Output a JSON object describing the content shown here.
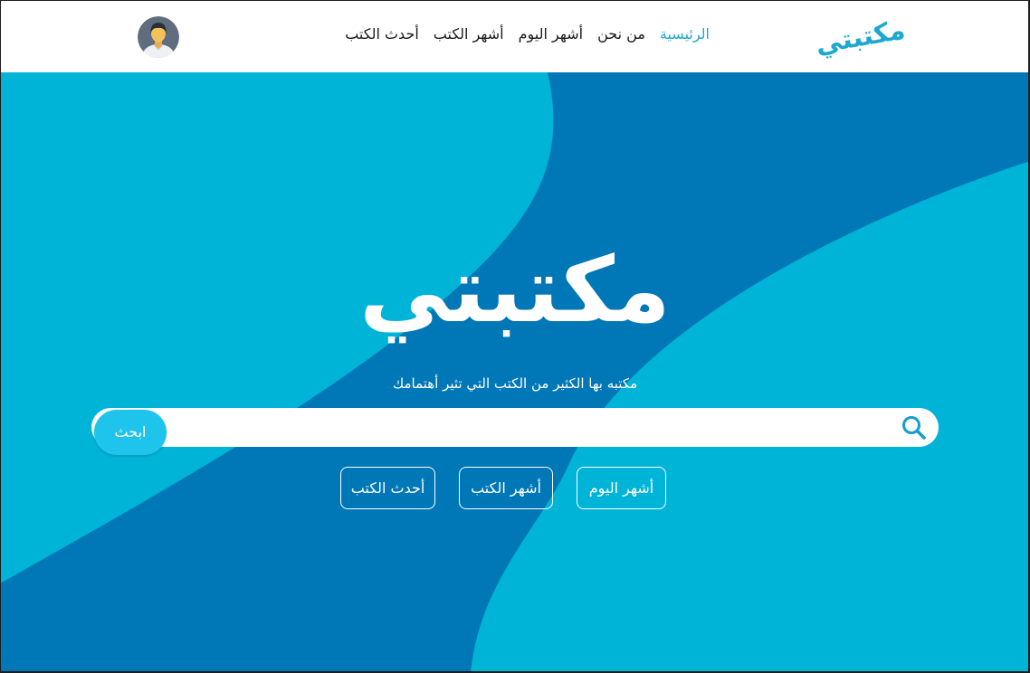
{
  "header": {
    "logo_text": "مكتبتي",
    "nav": [
      {
        "label": "الرئيسية",
        "active": true
      },
      {
        "label": "من نحن"
      },
      {
        "label": "أشهر اليوم"
      },
      {
        "label": "أشهر الكتب"
      },
      {
        "label": "أحدث الكتب"
      }
    ],
    "avatar_icon": "user-avatar-icon"
  },
  "hero": {
    "title": "مكتبتي",
    "subtitle": "مكتبه بها الكثير من الكتب التي تثير أهتمامك",
    "search": {
      "value": "",
      "button_label": "ابحث",
      "icon": "search-icon"
    },
    "quick_links": [
      {
        "label": "أشهر اليوم"
      },
      {
        "label": "أشهر الكتب"
      },
      {
        "label": "أحدث الكتب"
      }
    ]
  },
  "colors": {
    "accent": "#1ea7cf",
    "hero_light": "#00b4d8",
    "hero_dark": "#0077b6",
    "search_button": "#1fc4ec",
    "search_icon": "#129fcf",
    "nav_text": "#1a1a1a"
  }
}
